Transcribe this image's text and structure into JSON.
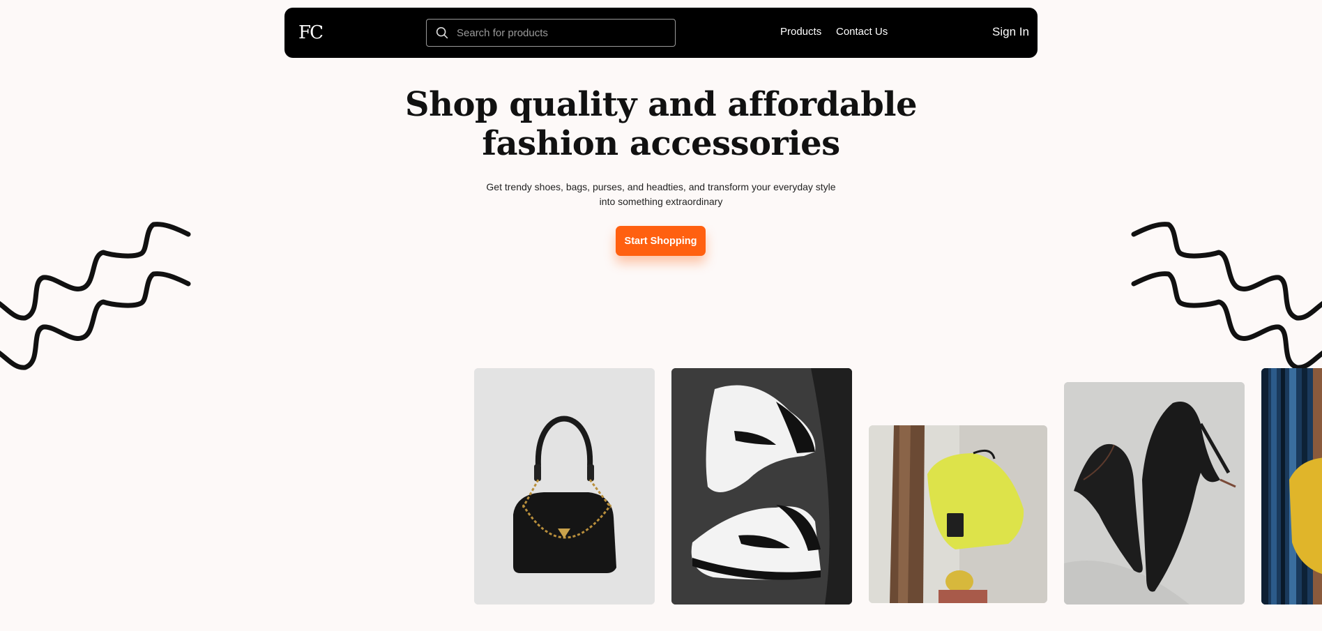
{
  "brand": {
    "logo_text": "FC",
    "accent_color": "#ff6010",
    "navbar_color": "#000000",
    "background_color": "#fdf9f8"
  },
  "nav": {
    "search_placeholder": "Search for products",
    "links": [
      {
        "label": "Products"
      },
      {
        "label": "Contact Us"
      }
    ],
    "sign_in_label": "Sign In"
  },
  "hero": {
    "title_line1": "Shop quality and affordable",
    "title_line2": "fashion accessories",
    "subtitle_line1": "Get trendy shoes, bags, purses, and headties, and transform your everyday style",
    "subtitle_line2": "into something extraordinary",
    "cta_label": "Start Shopping"
  },
  "products": [
    {
      "image": "black-shoulder-bag-with-gold-chain"
    },
    {
      "image": "black-and-white-high-top-sneakers"
    },
    {
      "image": "yellow-crossbody-bag-on-wood"
    },
    {
      "image": "black-suede-stiletto-heels"
    },
    {
      "image": "yellow-bag-on-blue-background"
    }
  ],
  "decorations": {
    "left": "zigzag-lines",
    "right": "zigzag-lines"
  }
}
